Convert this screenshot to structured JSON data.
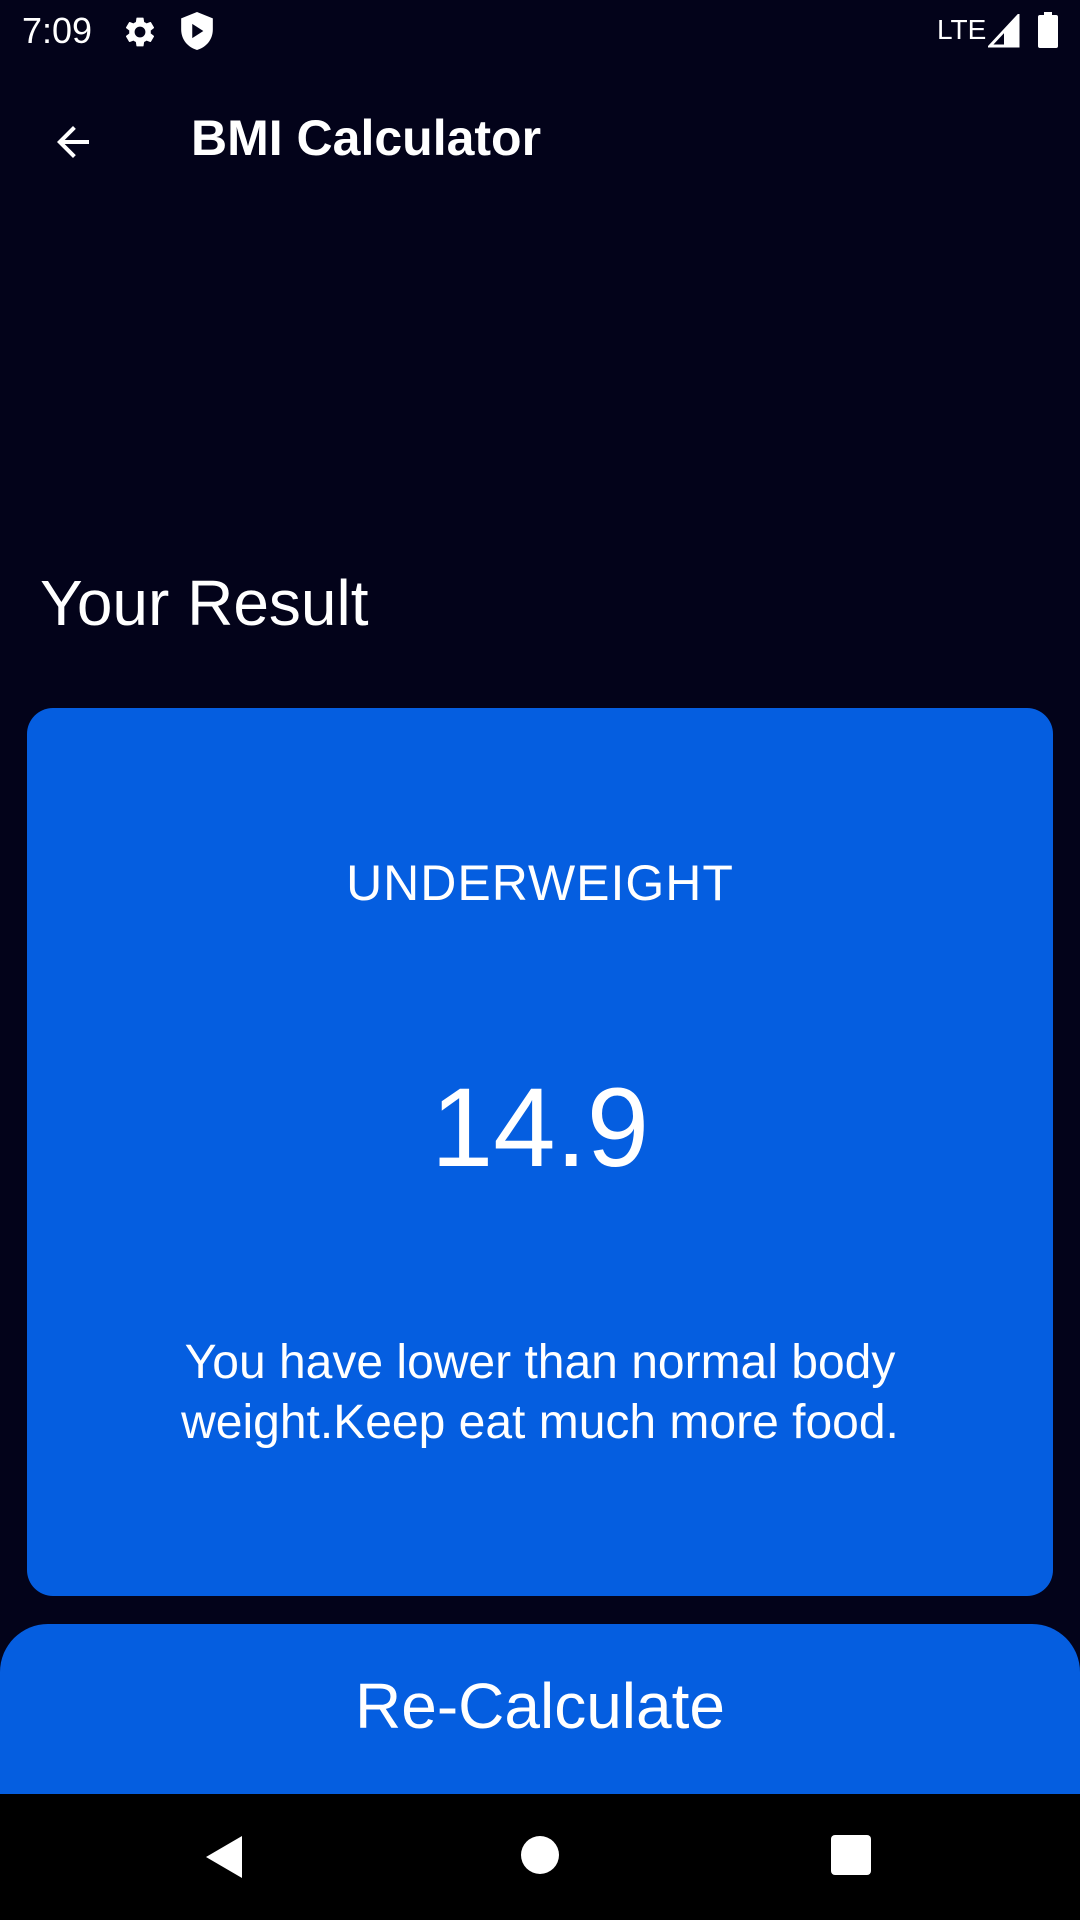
{
  "status_bar": {
    "time": "7:09",
    "network": "LTE",
    "icons": [
      "gear-icon",
      "shield-icon",
      "signal-icon",
      "battery-icon"
    ]
  },
  "app_bar": {
    "title": "BMI Calculator",
    "back_icon": "arrow-back-icon"
  },
  "result": {
    "heading": "Your Result",
    "status": "UNDERWEIGHT",
    "bmi_value": "14.9",
    "message": "You have lower than normal body weight.Keep eat much more food."
  },
  "actions": {
    "recalculate_label": "Re-Calculate"
  },
  "nav_bar": {
    "icons": [
      "nav-back-icon",
      "nav-home-icon",
      "nav-recents-icon"
    ]
  },
  "colors": {
    "background": "#03031a",
    "card": "#055ee0",
    "button": "#055ee0",
    "text": "#ffffff",
    "nav_bar": "#000000"
  }
}
